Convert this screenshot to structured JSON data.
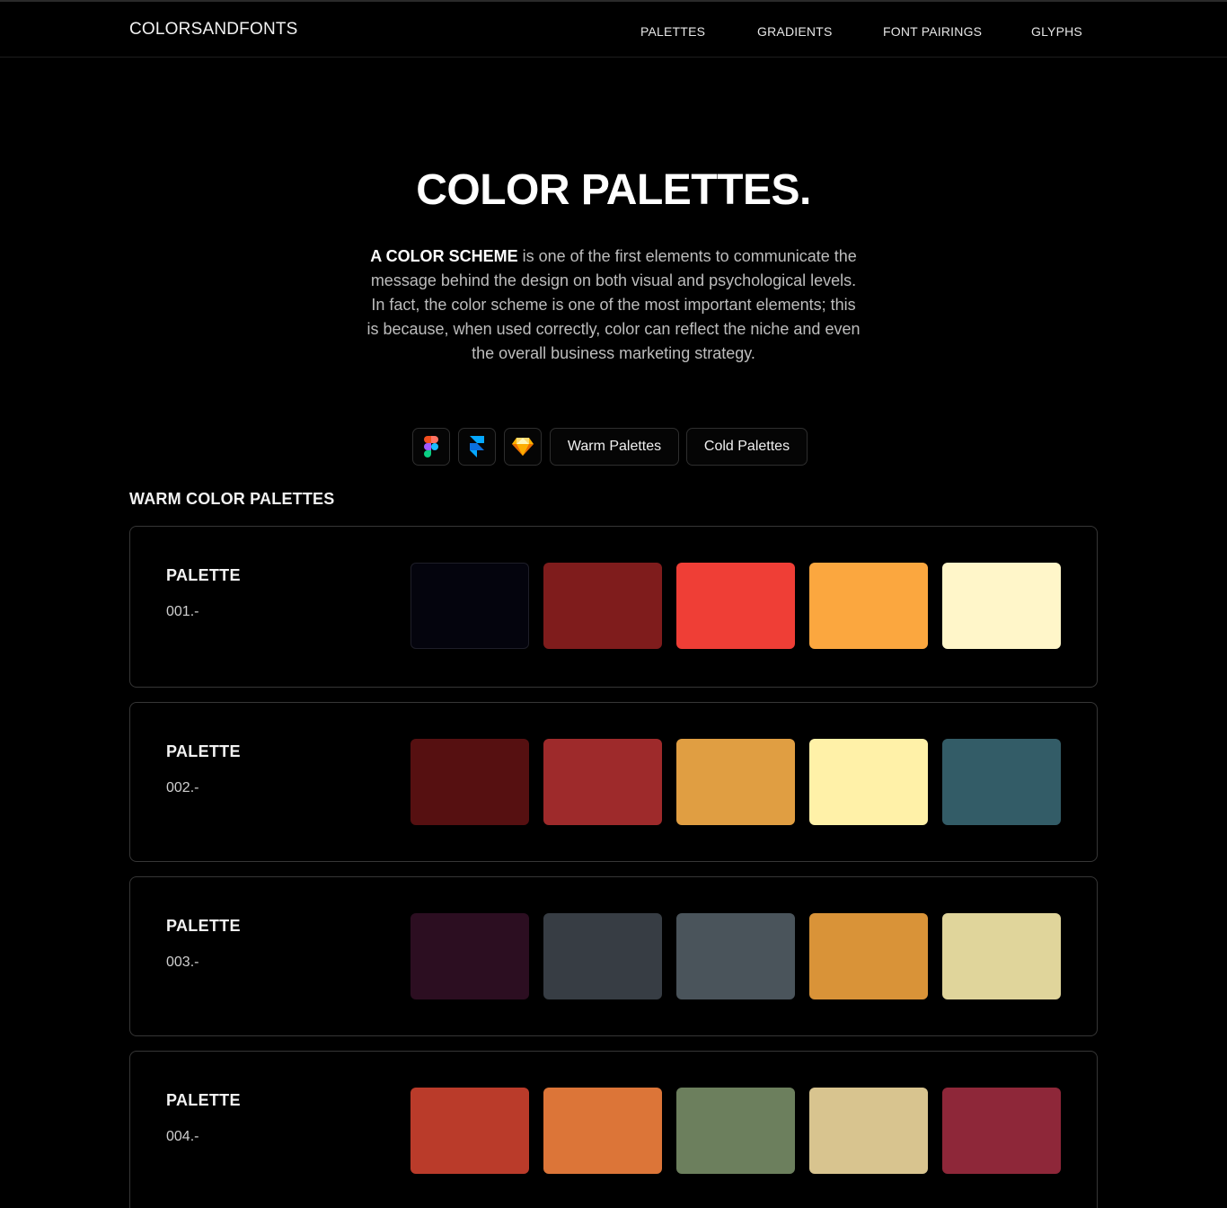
{
  "header": {
    "logo": "COLORSANDFONTS",
    "nav": [
      "PALETTES",
      "GRADIENTS",
      "FONT PAIRINGS",
      "GLYPHS"
    ]
  },
  "hero": {
    "title": "COLOR PALETTES.",
    "lead_bold": "A COLOR SCHEME",
    "lead_rest": " is one of the first elements to communicate the message behind the design on both visual and psychological levels. In fact, the color scheme is one of the most important elements; this is because, when used correctly, color can reflect the niche and even the overall business marketing strategy."
  },
  "tools": {
    "icons": [
      "figma-icon",
      "framer-icon",
      "sketch-icon"
    ],
    "warm_label": "Warm Palettes",
    "cold_label": "Cold Palettes"
  },
  "section": {
    "title": "WARM COLOR PALETTES"
  },
  "palettes": [
    {
      "label": "PALETTE",
      "number": "001.-",
      "colors": [
        "#04040d",
        "#7f1c1c",
        "#ef3e36",
        "#fba73f",
        "#fff6c9"
      ]
    },
    {
      "label": "PALETTE",
      "number": "002.-",
      "colors": [
        "#561011",
        "#9e2a2b",
        "#e09e42",
        "#fff1a8",
        "#335c67"
      ]
    },
    {
      "label": "PALETTE",
      "number": "003.-",
      "colors": [
        "#2c0e21",
        "#373d44",
        "#4a545b",
        "#d99338",
        "#e0d59b"
      ]
    },
    {
      "label": "PALETTE",
      "number": "004.-",
      "colors": [
        "#ba3b2a",
        "#dc7538",
        "#6c7f5d",
        "#d8c48f",
        "#8e2739"
      ]
    }
  ]
}
